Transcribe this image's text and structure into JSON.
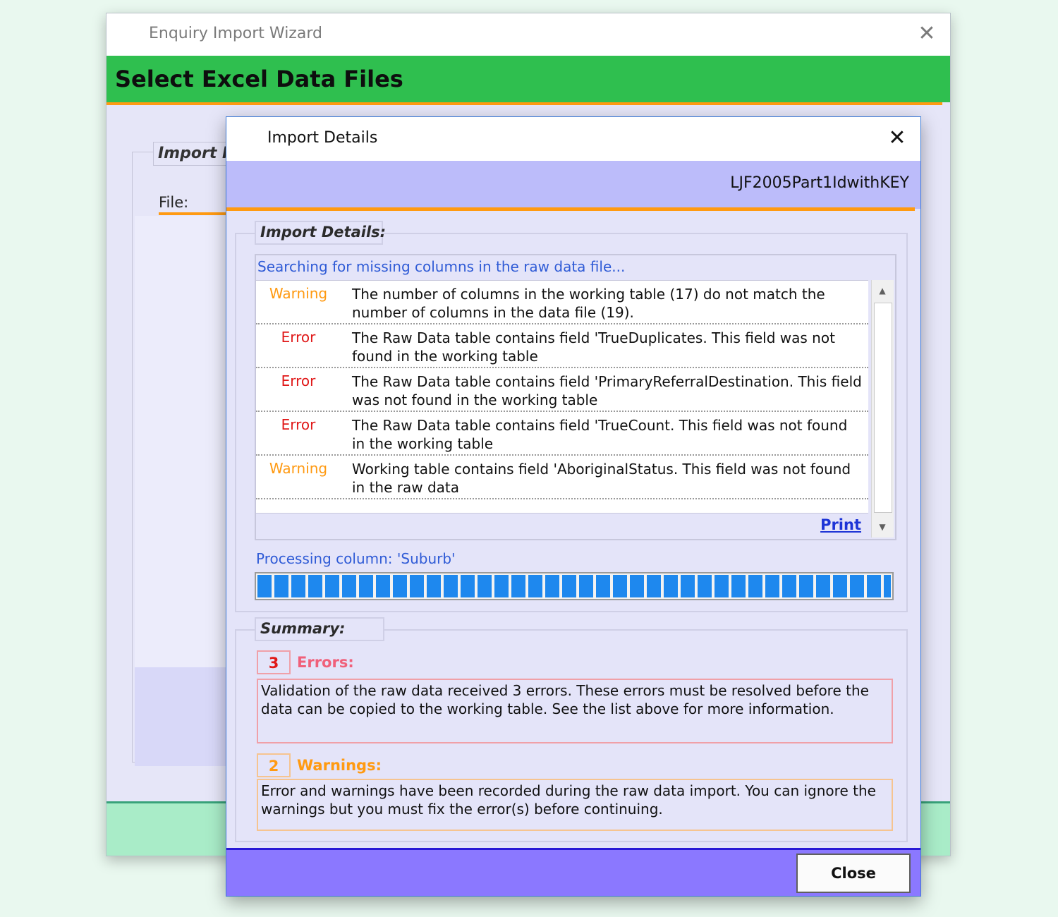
{
  "wizard": {
    "title": "Enquiry Import Wizard",
    "close_glyph": "✕",
    "header": "Select Excel Data Files",
    "group_legend": "Import R",
    "file_label": "File:"
  },
  "dialog": {
    "title": "Import Details",
    "close_glyph": "✕",
    "file_name": "LJF2005Part1IdwithKEY",
    "details_legend": "Import Details:",
    "status_text": "Searching for missing columns in the raw data file...",
    "messages": [
      {
        "severity": "Warning",
        "text": "The number of columns in the working table (17) do not match the number of columns in the data file (19)."
      },
      {
        "severity": "Error",
        "text": "The Raw Data table contains field 'TrueDuplicates. This field was not found in the working table"
      },
      {
        "severity": "Error",
        "text": "The Raw Data table contains field 'PrimaryReferralDestination. This field was not found in the working table"
      },
      {
        "severity": "Error",
        "text": "The Raw Data table contains field 'TrueCount. This field was not found in the working table"
      },
      {
        "severity": "Warning",
        "text": "Working table contains field 'AboriginalStatus. This field was not found in the raw data"
      }
    ],
    "print_link": "Print",
    "scroll_up_glyph": "▲",
    "scroll_down_glyph": "▼",
    "processing_text": "Processing column: 'Suburb'",
    "progress_percent": 100,
    "summary_legend": "Summary:",
    "errors": {
      "count": "3",
      "label": "Errors:",
      "message": "Validation of the raw data received 3 errors. These errors must be resolved before the data can be copied to the working table. See the list above for more information."
    },
    "warnings": {
      "count": "2",
      "label": "Warnings:",
      "message": "Error and warnings have been recorded during the raw data import. You can ignore the warnings but you must fix the error(s) before continuing."
    },
    "close_button": "Close"
  },
  "colors": {
    "wizard_header_green": "#2fbf4f",
    "accent_orange": "#ff9a12",
    "error_red": "#e01818",
    "warning_orange": "#ff9a12",
    "info_blue": "#2f5bd6",
    "progress_blue": "#1e88ee",
    "dialog_footer_purple": "#8b78ff"
  }
}
